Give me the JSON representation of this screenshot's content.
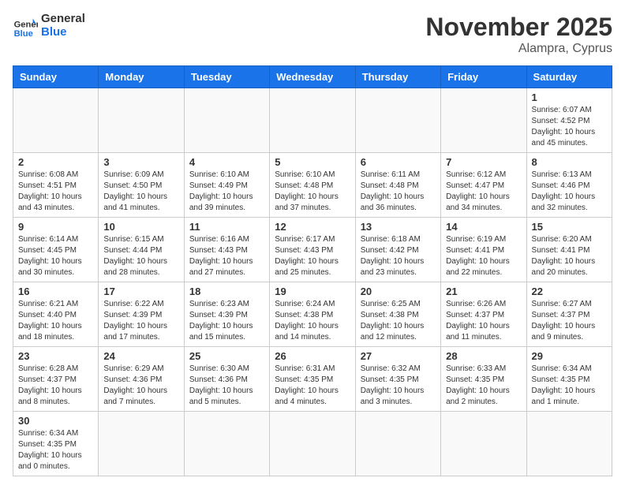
{
  "header": {
    "logo_general": "General",
    "logo_blue": "Blue",
    "month_title": "November 2025",
    "subtitle": "Alampra, Cyprus"
  },
  "weekdays": [
    "Sunday",
    "Monday",
    "Tuesday",
    "Wednesday",
    "Thursday",
    "Friday",
    "Saturday"
  ],
  "weeks": [
    [
      {
        "day": "",
        "info": ""
      },
      {
        "day": "",
        "info": ""
      },
      {
        "day": "",
        "info": ""
      },
      {
        "day": "",
        "info": ""
      },
      {
        "day": "",
        "info": ""
      },
      {
        "day": "",
        "info": ""
      },
      {
        "day": "1",
        "info": "Sunrise: 6:07 AM\nSunset: 4:52 PM\nDaylight: 10 hours\nand 45 minutes."
      }
    ],
    [
      {
        "day": "2",
        "info": "Sunrise: 6:08 AM\nSunset: 4:51 PM\nDaylight: 10 hours\nand 43 minutes."
      },
      {
        "day": "3",
        "info": "Sunrise: 6:09 AM\nSunset: 4:50 PM\nDaylight: 10 hours\nand 41 minutes."
      },
      {
        "day": "4",
        "info": "Sunrise: 6:10 AM\nSunset: 4:49 PM\nDaylight: 10 hours\nand 39 minutes."
      },
      {
        "day": "5",
        "info": "Sunrise: 6:10 AM\nSunset: 4:48 PM\nDaylight: 10 hours\nand 37 minutes."
      },
      {
        "day": "6",
        "info": "Sunrise: 6:11 AM\nSunset: 4:48 PM\nDaylight: 10 hours\nand 36 minutes."
      },
      {
        "day": "7",
        "info": "Sunrise: 6:12 AM\nSunset: 4:47 PM\nDaylight: 10 hours\nand 34 minutes."
      },
      {
        "day": "8",
        "info": "Sunrise: 6:13 AM\nSunset: 4:46 PM\nDaylight: 10 hours\nand 32 minutes."
      }
    ],
    [
      {
        "day": "9",
        "info": "Sunrise: 6:14 AM\nSunset: 4:45 PM\nDaylight: 10 hours\nand 30 minutes."
      },
      {
        "day": "10",
        "info": "Sunrise: 6:15 AM\nSunset: 4:44 PM\nDaylight: 10 hours\nand 28 minutes."
      },
      {
        "day": "11",
        "info": "Sunrise: 6:16 AM\nSunset: 4:43 PM\nDaylight: 10 hours\nand 27 minutes."
      },
      {
        "day": "12",
        "info": "Sunrise: 6:17 AM\nSunset: 4:43 PM\nDaylight: 10 hours\nand 25 minutes."
      },
      {
        "day": "13",
        "info": "Sunrise: 6:18 AM\nSunset: 4:42 PM\nDaylight: 10 hours\nand 23 minutes."
      },
      {
        "day": "14",
        "info": "Sunrise: 6:19 AM\nSunset: 4:41 PM\nDaylight: 10 hours\nand 22 minutes."
      },
      {
        "day": "15",
        "info": "Sunrise: 6:20 AM\nSunset: 4:41 PM\nDaylight: 10 hours\nand 20 minutes."
      }
    ],
    [
      {
        "day": "16",
        "info": "Sunrise: 6:21 AM\nSunset: 4:40 PM\nDaylight: 10 hours\nand 18 minutes."
      },
      {
        "day": "17",
        "info": "Sunrise: 6:22 AM\nSunset: 4:39 PM\nDaylight: 10 hours\nand 17 minutes."
      },
      {
        "day": "18",
        "info": "Sunrise: 6:23 AM\nSunset: 4:39 PM\nDaylight: 10 hours\nand 15 minutes."
      },
      {
        "day": "19",
        "info": "Sunrise: 6:24 AM\nSunset: 4:38 PM\nDaylight: 10 hours\nand 14 minutes."
      },
      {
        "day": "20",
        "info": "Sunrise: 6:25 AM\nSunset: 4:38 PM\nDaylight: 10 hours\nand 12 minutes."
      },
      {
        "day": "21",
        "info": "Sunrise: 6:26 AM\nSunset: 4:37 PM\nDaylight: 10 hours\nand 11 minutes."
      },
      {
        "day": "22",
        "info": "Sunrise: 6:27 AM\nSunset: 4:37 PM\nDaylight: 10 hours\nand 9 minutes."
      }
    ],
    [
      {
        "day": "23",
        "info": "Sunrise: 6:28 AM\nSunset: 4:37 PM\nDaylight: 10 hours\nand 8 minutes."
      },
      {
        "day": "24",
        "info": "Sunrise: 6:29 AM\nSunset: 4:36 PM\nDaylight: 10 hours\nand 7 minutes."
      },
      {
        "day": "25",
        "info": "Sunrise: 6:30 AM\nSunset: 4:36 PM\nDaylight: 10 hours\nand 5 minutes."
      },
      {
        "day": "26",
        "info": "Sunrise: 6:31 AM\nSunset: 4:35 PM\nDaylight: 10 hours\nand 4 minutes."
      },
      {
        "day": "27",
        "info": "Sunrise: 6:32 AM\nSunset: 4:35 PM\nDaylight: 10 hours\nand 3 minutes."
      },
      {
        "day": "28",
        "info": "Sunrise: 6:33 AM\nSunset: 4:35 PM\nDaylight: 10 hours\nand 2 minutes."
      },
      {
        "day": "29",
        "info": "Sunrise: 6:34 AM\nSunset: 4:35 PM\nDaylight: 10 hours\nand 1 minute."
      }
    ],
    [
      {
        "day": "30",
        "info": "Sunrise: 6:34 AM\nSunset: 4:35 PM\nDaylight: 10 hours\nand 0 minutes."
      },
      {
        "day": "",
        "info": ""
      },
      {
        "day": "",
        "info": ""
      },
      {
        "day": "",
        "info": ""
      },
      {
        "day": "",
        "info": ""
      },
      {
        "day": "",
        "info": ""
      },
      {
        "day": "",
        "info": ""
      }
    ]
  ]
}
